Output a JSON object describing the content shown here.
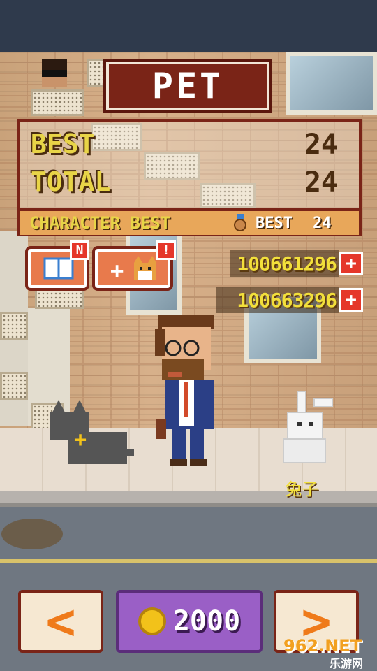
{
  "screen": {
    "title": "PET"
  },
  "stats": {
    "best_label": "BEST",
    "best_value": "24",
    "total_label": "TOTAL",
    "total_value": "24",
    "character_best_label": "CHARACTER BEST",
    "character_best_sub_label": "BEST",
    "character_best_value": "24"
  },
  "buttons": {
    "book_badge": "N",
    "add_pet_badge": "!",
    "add_pet_plus": "+"
  },
  "currency": {
    "row1_value": "100661296",
    "row2_value": "100663296",
    "plus_label": "+"
  },
  "pet": {
    "name": "兔子",
    "cat_plus": "+"
  },
  "bottom": {
    "prev_glyph": "<",
    "next_glyph": ">",
    "price": "2000"
  },
  "watermark": {
    "site": "962.NET",
    "sub": "乐游网"
  },
  "colors": {
    "title_bg": "#7a2417",
    "stat_yellow": "#e8d447",
    "price_purple": "#9a5fc6",
    "nav_orange": "#ef7a1a"
  },
  "icons": [
    "book-icon",
    "cat-face-icon",
    "medal-icon",
    "coin-icon",
    "plus-icon",
    "chevron-left-icon",
    "chevron-right-icon"
  ]
}
